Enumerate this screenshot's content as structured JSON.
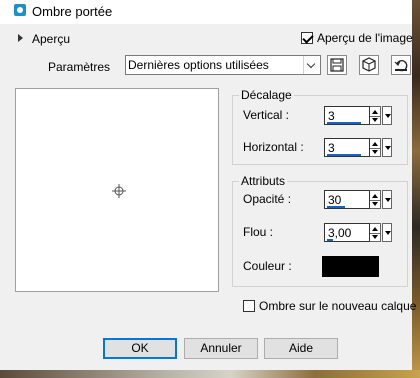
{
  "window": {
    "title": "Ombre portée",
    "app_icon": "dialog-app-icon"
  },
  "preview_toggle": {
    "label": "Aperçu"
  },
  "image_preview": {
    "label": "Aperçu de l'image",
    "checked": true
  },
  "params": {
    "label": "Paramètres",
    "preset": "Dernières options utilisées",
    "buttons": [
      "save-preset-icon",
      "random-cube-icon",
      "reset-icon"
    ]
  },
  "offset": {
    "title": "Décalage",
    "vertical": {
      "label": "Vertical :",
      "value": "3"
    },
    "horizontal": {
      "label": "Horizontal :",
      "value": "3"
    }
  },
  "attributes": {
    "title": "Attributs",
    "opacity": {
      "label": "Opacité :",
      "value": "30"
    },
    "blur": {
      "label": "Flou :",
      "value": "3,00"
    },
    "color": {
      "label": "Couleur :",
      "value": "#000000"
    }
  },
  "new_layer": {
    "label": "Ombre sur le nouveau calque",
    "checked": false
  },
  "footer": {
    "ok": "OK",
    "cancel": "Annuler",
    "help": "Aide"
  }
}
